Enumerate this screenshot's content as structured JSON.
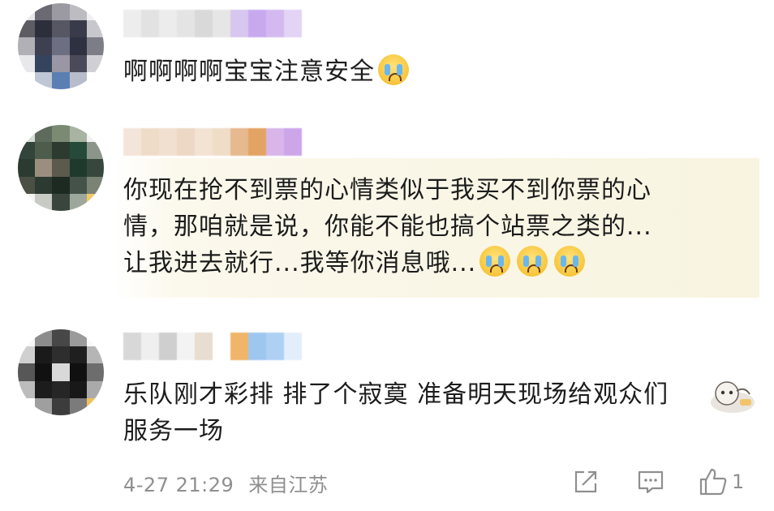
{
  "comments": [
    {
      "text_lines": [
        "啊啊啊啊宝宝注意安全"
      ],
      "emoji": [
        "crying-face"
      ]
    },
    {
      "text_lines": [
        "你现在抢不到票的心情类似于我买不到你票的心",
        "情，那咱就是说，你能不能也搞个站票之类的...",
        "让我进去就行...我等你消息哦..."
      ],
      "emoji": [
        "crying-face",
        "crying-face",
        "crying-face"
      ],
      "background": "#f8f4e0"
    },
    {
      "text_lines": [
        "乐队刚才彩排 排了个寂寞 准备明天现场给观众们",
        "服务一场"
      ],
      "timestamp": "4-27 21:29",
      "source": "来自江苏",
      "like_count": "1"
    }
  ],
  "icons": {
    "share": "share-icon",
    "reply": "comment-icon",
    "like": "thumbs-up-icon"
  },
  "colors": {
    "text": "#1c1c1c",
    "meta": "#8f8f8f",
    "highlight": "#f8f4e0"
  }
}
